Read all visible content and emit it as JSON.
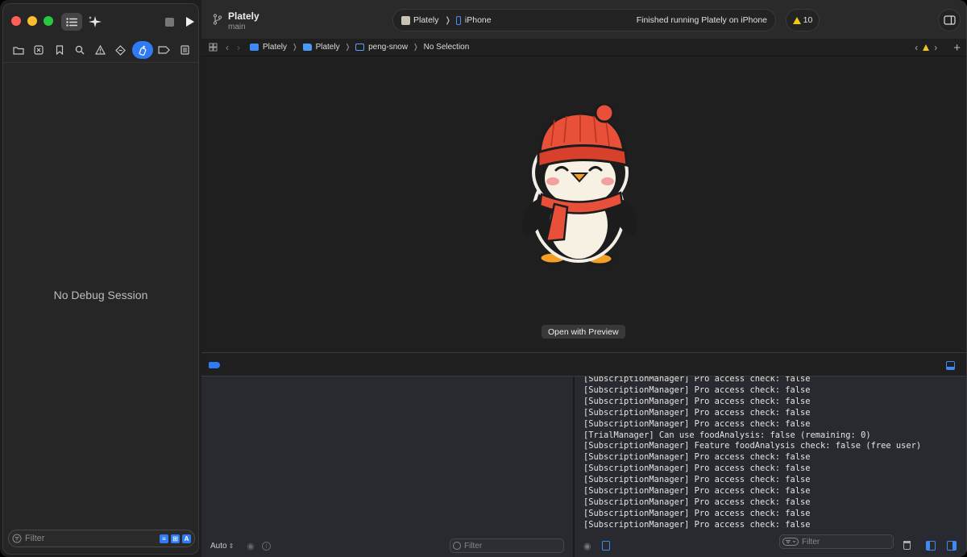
{
  "window": {
    "project_name": "Plately",
    "branch": "main",
    "scheme": "Plately",
    "device": "iPhone",
    "status": "Finished running Plately on iPhone",
    "warning_count": "10"
  },
  "sidebar": {
    "empty_state": "No Debug Session",
    "filter_placeholder": "Filter",
    "navigator_icons": [
      "folder-icon",
      "source-control-icon",
      "bookmark-icon",
      "find-icon",
      "issue-icon",
      "test-icon",
      "debug-icon",
      "breakpoint-icon",
      "report-icon"
    ],
    "active_navigator": "debug-icon"
  },
  "jumpbar": {
    "crumbs": [
      "Plately",
      "Plately",
      "peng-snow",
      "No Selection"
    ]
  },
  "editor": {
    "open_with_preview": "Open with Preview"
  },
  "variables": {
    "scope": "Auto",
    "filter_placeholder": "Filter"
  },
  "console": {
    "filter_placeholder": "Filter",
    "lines": [
      "[SubscriptionManager] Pro access check: false",
      "[SubscriptionManager] Pro access check: false",
      "[SubscriptionManager] Pro access check: false",
      "[SubscriptionManager] Pro access check: false",
      "[SubscriptionManager] Pro access check: false",
      "[TrialManager] Can use foodAnalysis: false (remaining: 0)",
      "[SubscriptionManager] Feature foodAnalysis check: false (free user)",
      "[SubscriptionManager] Pro access check: false",
      "[SubscriptionManager] Pro access check: false",
      "[SubscriptionManager] Pro access check: false",
      "[SubscriptionManager] Pro access check: false",
      "[SubscriptionManager] Pro access check: false",
      "[SubscriptionManager] Pro access check: false",
      "[SubscriptionManager] Pro access check: false"
    ]
  },
  "colors": {
    "accent": "#2f7bf5",
    "warning": "#f5c518",
    "penguin_hat": "#e8503a",
    "penguin_body": "#1c1c1c"
  }
}
